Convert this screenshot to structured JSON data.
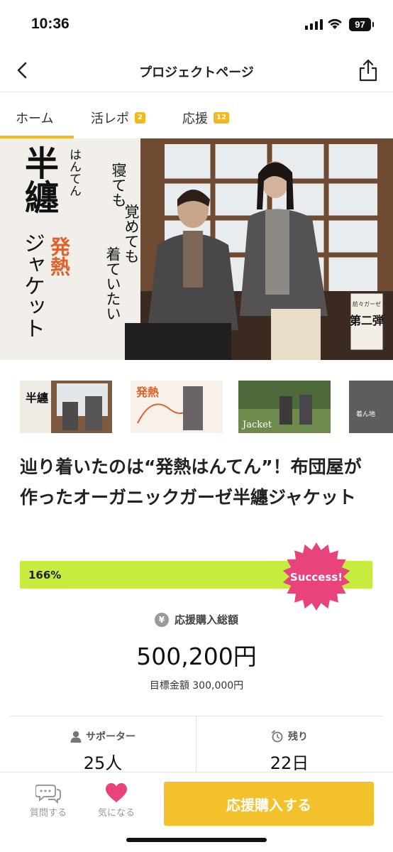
{
  "status_bar": {
    "time": "10:36",
    "battery": "97"
  },
  "nav": {
    "title": "プロジェクトページ"
  },
  "tabs": [
    {
      "label": "ホーム",
      "badge": null,
      "active": true
    },
    {
      "label": "活レポ",
      "badge": "2",
      "active": false
    },
    {
      "label": "応援",
      "badge": "12",
      "active": false
    }
  ],
  "hero": {
    "main_title": "半纏",
    "ruby": "はんてん",
    "accent_word": "発熱",
    "sub_word": "ジャケット",
    "tagline": [
      "寝ても",
      "覚めても",
      "着ていたい"
    ],
    "stamp_small": "紡々ガーゼ",
    "stamp_main": "第二弾",
    "accent_color": "#e0602b"
  },
  "thumbnails": [
    {
      "name": "hero-thumbnail",
      "text": "半纏"
    },
    {
      "name": "heat-thumbnail",
      "text": "発熱"
    },
    {
      "name": "homecoming-thumbnail",
      "text": "Jacket"
    },
    {
      "name": "closeup-thumbnail",
      "text": "着ん地"
    }
  ],
  "project": {
    "title": "辿り着いたのは“発熱はんてん”！布団屋が作ったオーガニックガーゼ半纏ジャケット"
  },
  "progress": {
    "percent_label": "166%",
    "percent": 166,
    "success_label": "Success!",
    "bar_color": "#c5ec3e",
    "badge_color": "#e8437a"
  },
  "amount": {
    "label": "応援購入総額",
    "value": "500,200円",
    "goal": "目標金額 300,000円"
  },
  "stats": {
    "supporters": {
      "label": "サポーター",
      "value": "25人"
    },
    "remaining": {
      "label": "残り",
      "value": "22日"
    }
  },
  "bottom_bar": {
    "question_label": "質問する",
    "favorite_label": "気になる",
    "support_label": "応援購入する"
  }
}
